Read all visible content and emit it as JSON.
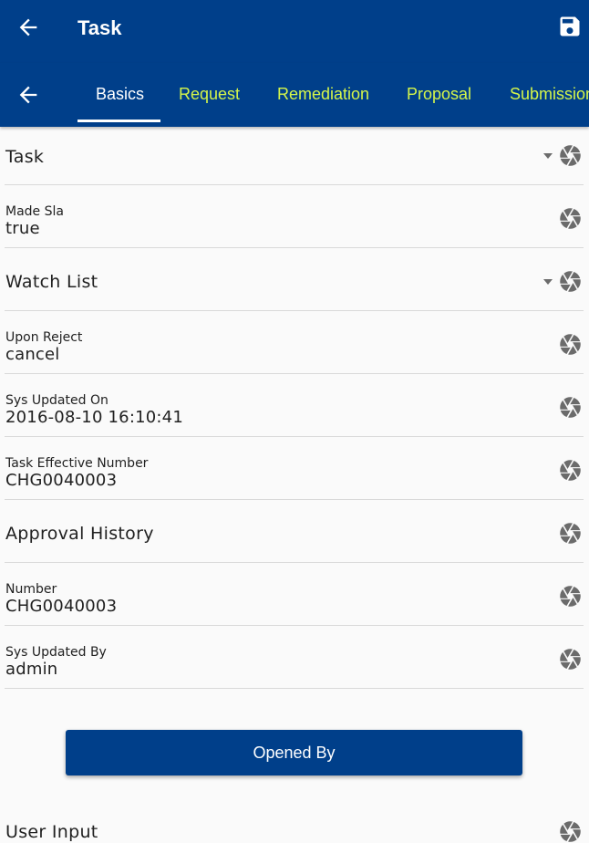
{
  "appbar": {
    "title": "Task",
    "back_icon": "arrow-left-icon",
    "save_icon": "save-icon"
  },
  "tabs": [
    {
      "label": "Basics",
      "active": true
    },
    {
      "label": "Request",
      "active": false
    },
    {
      "label": "Remediation",
      "active": false
    },
    {
      "label": "Proposal",
      "active": false
    },
    {
      "label": "Submission",
      "active": false
    }
  ],
  "fields": [
    {
      "label": "Task",
      "type": "dropdown"
    },
    {
      "label": "Made Sla",
      "value": "true"
    },
    {
      "label": "Watch List",
      "type": "dropdown"
    },
    {
      "label": "Upon Reject",
      "value": "cancel"
    },
    {
      "label": "Sys Updated On",
      "value": "2016-08-10 16:10:41"
    },
    {
      "label": "Task Effective Number",
      "value": "CHG0040003"
    },
    {
      "label": "Approval History",
      "type": "link"
    },
    {
      "label": "Number",
      "value": "CHG0040003"
    },
    {
      "label": "Sys Updated By",
      "value": "admin"
    }
  ],
  "opened_by_button": {
    "label": "Opened By"
  },
  "user_input": {
    "label": "User Input"
  },
  "colors": {
    "primary": "#003f8a",
    "tab_inactive": "#d4f54a",
    "icon_gray": "#6b6b6b"
  }
}
